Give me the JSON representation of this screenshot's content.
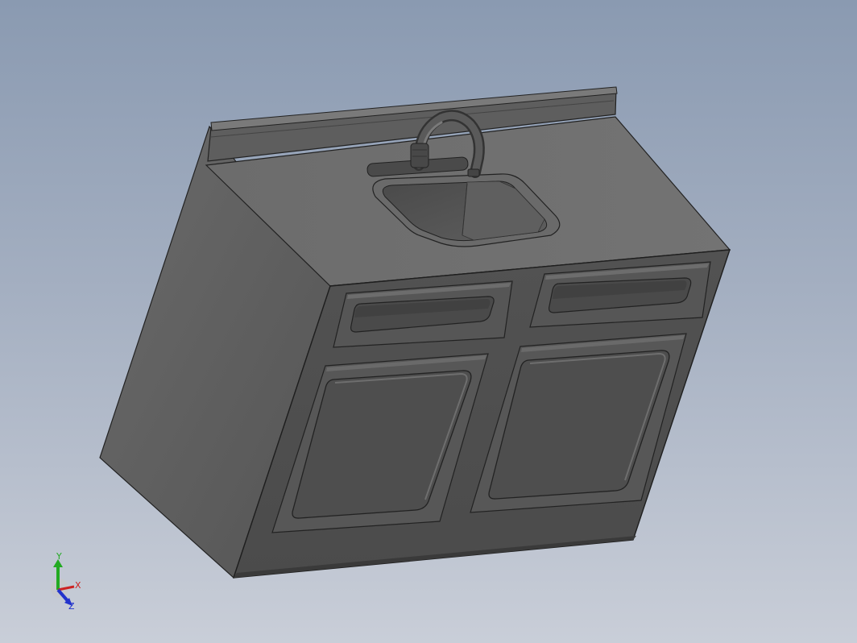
{
  "viewport": {
    "background_top": "#8a9ab1",
    "background_bottom": "#c9ced8"
  },
  "model": {
    "name": "sink-cabinet",
    "body_color": "#5c5c5c",
    "front_color": "#4e4e4e",
    "top_color": "#6e6e6e",
    "edge_color": "#1e1e1e"
  },
  "triad": {
    "x_label": "X",
    "y_label": "Y",
    "z_label": "Z",
    "x_color": "#cc2222",
    "y_color": "#22aa22",
    "z_color": "#2233cc"
  }
}
